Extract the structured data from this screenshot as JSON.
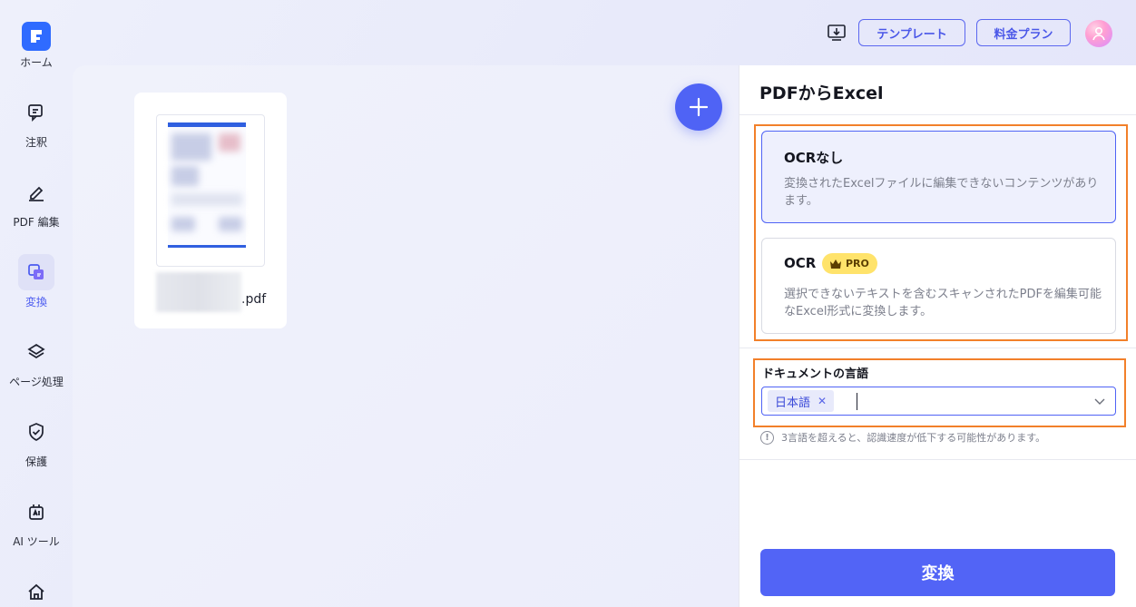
{
  "sidebar": {
    "items": [
      {
        "label": "ホーム",
        "icon": "home-logo-icon"
      },
      {
        "label": "注釈",
        "icon": "annotate-icon"
      },
      {
        "label": "PDF 編集",
        "icon": "edit-icon"
      },
      {
        "label": "変換",
        "icon": "convert-icon",
        "active": true
      },
      {
        "label": "ページ処理",
        "icon": "layers-icon"
      },
      {
        "label": "保護",
        "icon": "shield-icon"
      },
      {
        "label": "AI ツール",
        "icon": "ai-tools-icon"
      },
      {
        "label": "",
        "icon": "house-icon"
      }
    ]
  },
  "topbar": {
    "template_label": "テンプレート",
    "pricing_label": "料金プラン"
  },
  "workspace": {
    "file": {
      "extension": ".pdf"
    }
  },
  "panel": {
    "title": "PDFからExcel",
    "options": [
      {
        "title": "OCRなし",
        "description": "変換されたExcelファイルに編集できないコンテンツがあります。",
        "selected": true
      },
      {
        "title": "OCR",
        "badge": "PRO",
        "description": "選択できないテキストを含むスキャンされたPDFを編集可能なExcel形式に変換します。",
        "selected": false
      }
    ],
    "language": {
      "label": "ドキュメントの言語",
      "selected_tag": "日本語",
      "hint": "3言語を超えると、認識速度が低下する可能性があります。"
    },
    "convert_label": "変換"
  },
  "colors": {
    "accent": "#4f63f5",
    "highlight_border": "#f2802a",
    "pro_badge": "#ffe36b"
  }
}
